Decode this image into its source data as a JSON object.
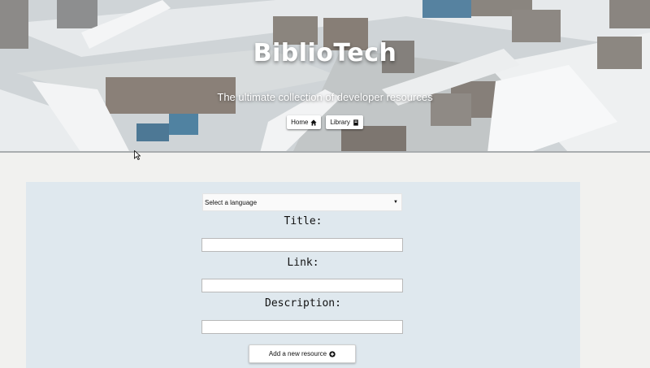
{
  "hero": {
    "title": "BiblioTech",
    "subtitle": "The ultimate collection of developer resources",
    "nav": [
      {
        "label": "Home",
        "icon": "home-icon"
      },
      {
        "label": "Library",
        "icon": "book-icon"
      }
    ]
  },
  "form": {
    "language_select": {
      "value": "Select a language"
    },
    "title_label": "Title:",
    "link_label": "Link:",
    "description_label": "Description:",
    "title_value": "",
    "link_value": "",
    "description_value": "",
    "submit_label": "Add a new resource",
    "submit_icon": "plus-circle-icon"
  },
  "colors": {
    "page_bg": "#f1f1ef",
    "panel_bg": "#dfe8ee",
    "button_bg": "#ffffff"
  }
}
